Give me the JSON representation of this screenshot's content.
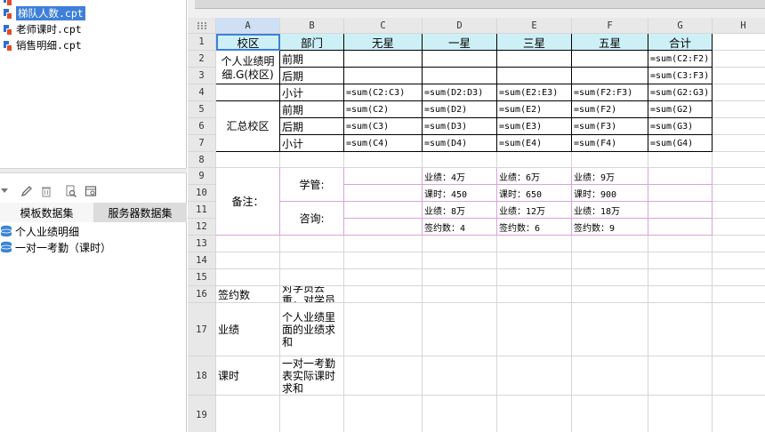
{
  "file_tree": {
    "files": [
      {
        "label": "梯队人数.cpt",
        "selected": true
      },
      {
        "label": "老师课时.cpt",
        "selected": false
      },
      {
        "label": "销售明细.cpt",
        "selected": false
      }
    ]
  },
  "dataset_panel": {
    "tabs": [
      "模板数据集",
      "服务器数据集"
    ],
    "datasets": [
      "个人业绩明细",
      "一对一考勤（课时）"
    ]
  },
  "sheet": {
    "columns": [
      "A",
      "B",
      "C",
      "D",
      "E",
      "F",
      "G",
      "H"
    ],
    "rows": [
      "1",
      "2",
      "3",
      "4",
      "5",
      "6",
      "7",
      "8",
      "9",
      "10",
      "11",
      "12",
      "13",
      "14",
      "15",
      "16",
      "17",
      "18",
      "19"
    ],
    "cells": {
      "A1": "校区",
      "B1": "部门",
      "C1": "无星",
      "D1": "一星",
      "E1": "三星",
      "F1": "五星",
      "G1": "合计",
      "A2": "个人业绩明细.G(校区)",
      "B2": "前期",
      "G2": "=sum(C2:F2)",
      "B3": "后期",
      "G3": "=sum(C3:F3)",
      "B4": "小计",
      "C4": "=sum(C2:C3)",
      "D4": "=sum(D2:D3)",
      "E4": "=sum(E2:E3)",
      "F4": "=sum(F2:F3)",
      "G4": "=sum(G2:G3)",
      "A5": "汇总校区",
      "B5": "前期",
      "C5": "=sum(C2)",
      "D5": "=sum(D2)",
      "E5": "=sum(E2)",
      "F5": "=sum(F2)",
      "G5": "=sum(G2)",
      "B6": "后期",
      "C6": "=sum(C3)",
      "D6": "=sum(D3)",
      "E6": "=sum(E3)",
      "F6": "=sum(F3)",
      "G6": "=sum(G3)",
      "B7": "小计",
      "C7": "=sum(C4)",
      "D7": "=sum(D4)",
      "E7": "=sum(E4)",
      "F7": "=sum(F4)",
      "G7": "=sum(G4)",
      "A9": "备注：",
      "B9": "学管:",
      "D9": "业绩：4万",
      "E9": "业绩：6万",
      "F9": "业绩：9万",
      "D10": "课时：450",
      "E10": "课时：650",
      "F10": "课时：900",
      "B11": "咨询:",
      "D11": "业绩：8万",
      "E11": "业绩：12万",
      "F11": "业绩：18万",
      "D12": "签约数：4",
      "E12": "签约数：6",
      "F12": "签约数：9",
      "A16": "签约数",
      "B16": "个人业绩表对学员去重，对学员统计个数",
      "A17": "业绩",
      "B17": "个人业绩里面的业绩求和",
      "A18": "课时",
      "B18": "一对一考勤表实际课时求和"
    }
  },
  "colors": {
    "header_fill": "#cdf0f7",
    "selection": "#3d7fd9",
    "grid_line": "#d6d6d6",
    "remark_border": "#d9a3d9"
  }
}
